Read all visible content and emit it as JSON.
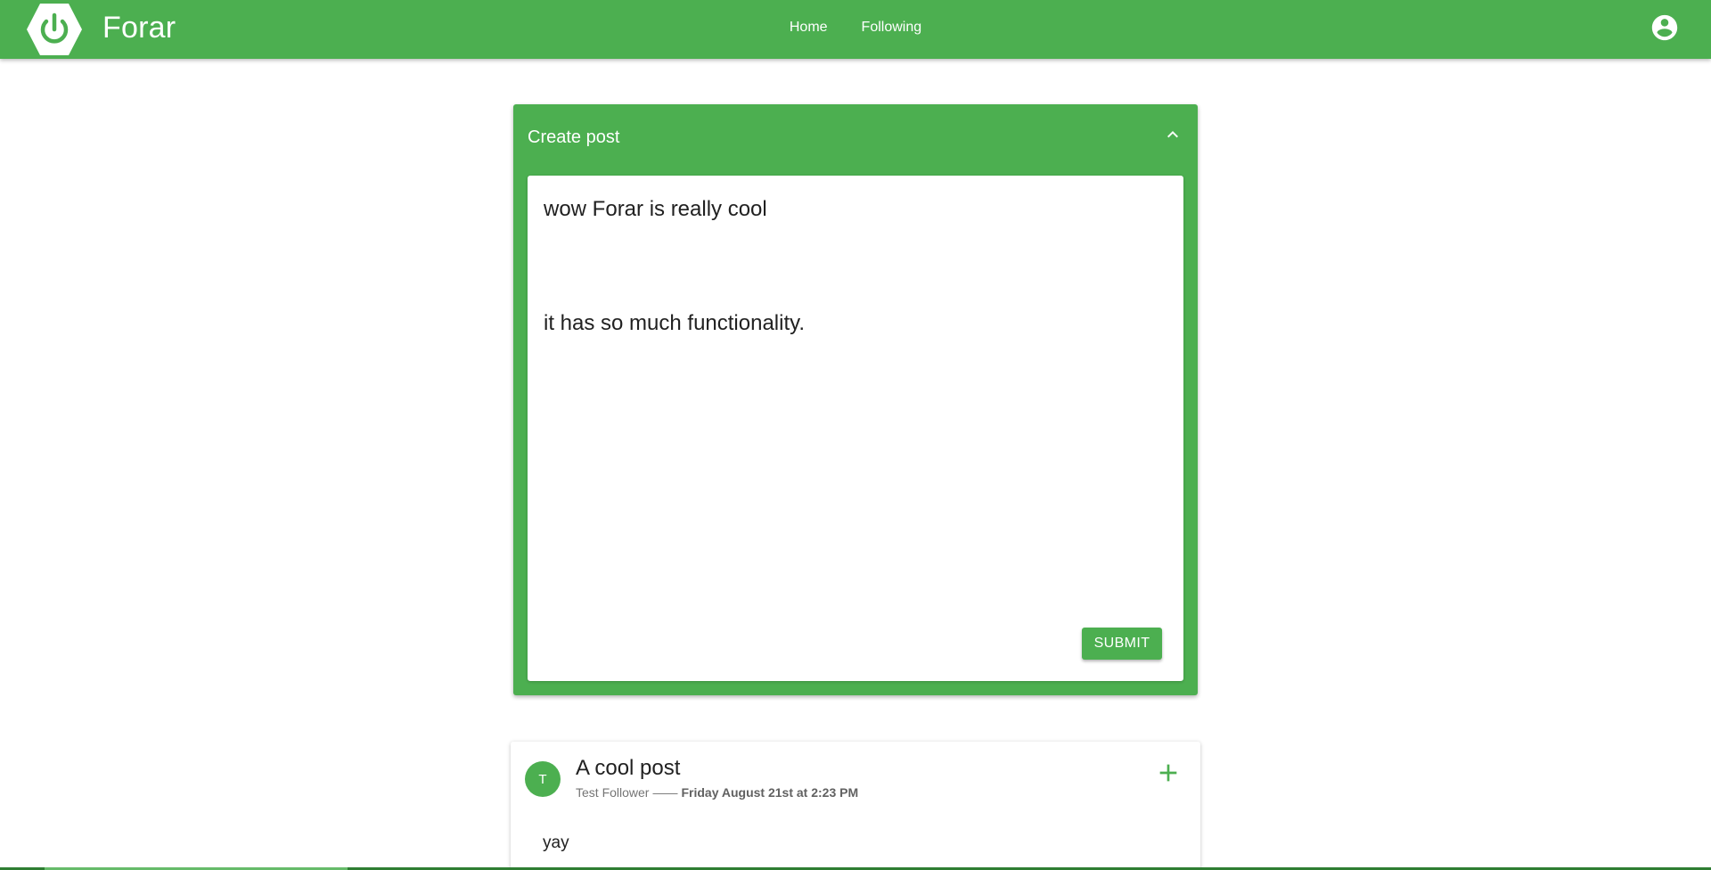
{
  "app": {
    "brand": "Forar",
    "colors": {
      "primary": "#4caf50",
      "text": "#212121",
      "muted": "#757575"
    }
  },
  "nav": {
    "items": [
      {
        "label": "Home"
      },
      {
        "label": "Following"
      }
    ],
    "account_icon": "account-circle-icon",
    "logo_icon": "power-icon"
  },
  "create_post": {
    "title": "Create post",
    "collapse_icon": "chevron-up-icon",
    "editor": {
      "line1": "wow Forar is really cool",
      "line2": "it has so much functionality."
    },
    "submit_label": "SUBMIT"
  },
  "post": {
    "avatar_letter": "T",
    "title": "A cool post",
    "author": "Test Follower",
    "separator": "——",
    "date": "Friday August 21st at 2:23 PM",
    "body": "yay",
    "add_icon": "plus-icon"
  }
}
